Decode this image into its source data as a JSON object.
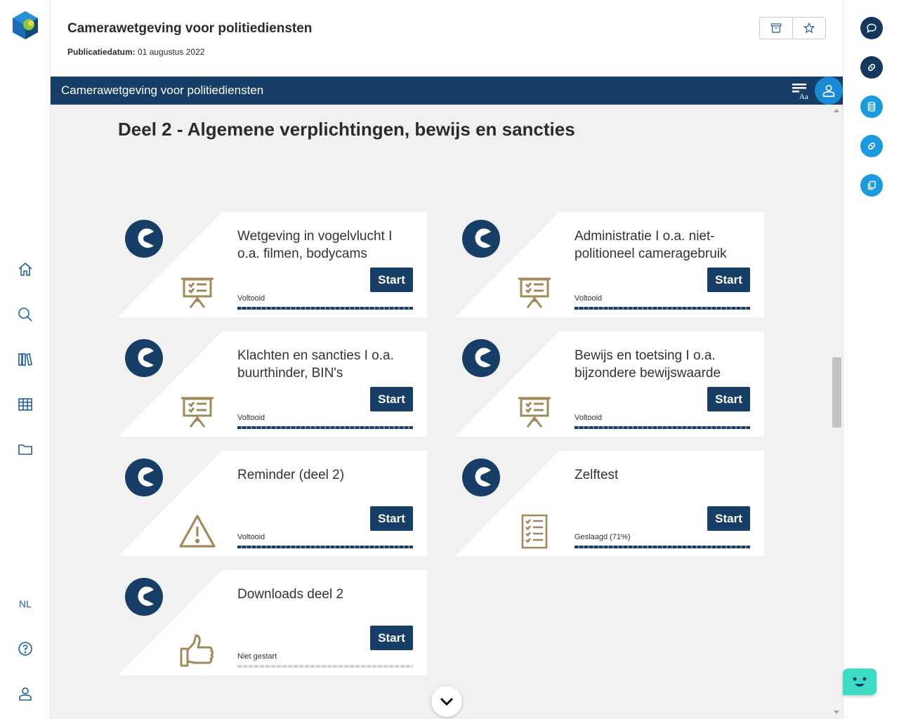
{
  "header": {
    "title": "Camerawetgeving voor politiediensten",
    "pub_label": "Publicatiedatum:",
    "pub_date": "01 augustus 2022"
  },
  "bar": {
    "title": "Camerawetgeving voor politiediensten"
  },
  "section": {
    "title": "Deel 2 - Algemene verplichtingen, bewijs en sancties"
  },
  "language": "NL",
  "cards": [
    {
      "title": "Wetgeving in vogelvlucht I o.a. filmen, bodycams",
      "start": "Start",
      "status": "Voltooid",
      "icon": "presentation-icon",
      "progress": 1.0
    },
    {
      "title": "Administratie I o.a. niet-politioneel cameragebruik",
      "start": "Start",
      "status": "Voltooid",
      "icon": "presentation-icon",
      "progress": 1.0
    },
    {
      "title": "Klachten en sancties I o.a. buurthinder, BIN's",
      "start": "Start",
      "status": "Voltooid",
      "icon": "presentation-icon",
      "progress": 1.0
    },
    {
      "title": "Bewijs en toetsing I o.a. bijzondere bewijswaarde",
      "start": "Start",
      "status": "Voltooid",
      "icon": "presentation-icon",
      "progress": 1.0
    },
    {
      "title": "Reminder (deel 2)",
      "start": "Start",
      "status": "Voltooid",
      "icon": "warning-icon",
      "progress": 1.0
    },
    {
      "title": "Zelftest",
      "start": "Start",
      "status": "Geslaagd (71%)",
      "icon": "checklist-icon",
      "progress": 1.0
    },
    {
      "title": "Downloads deel 2",
      "start": "Start",
      "status": "Niet gestart",
      "icon": "thumbs-up-icon",
      "progress": 0.0
    }
  ],
  "colors": {
    "navy": "#173e67",
    "accent_blue": "#1a9be0",
    "icon_gold": "#a08a5a",
    "content_bg": "#f1f1f1",
    "bot_teal": "#3ddbc4"
  }
}
